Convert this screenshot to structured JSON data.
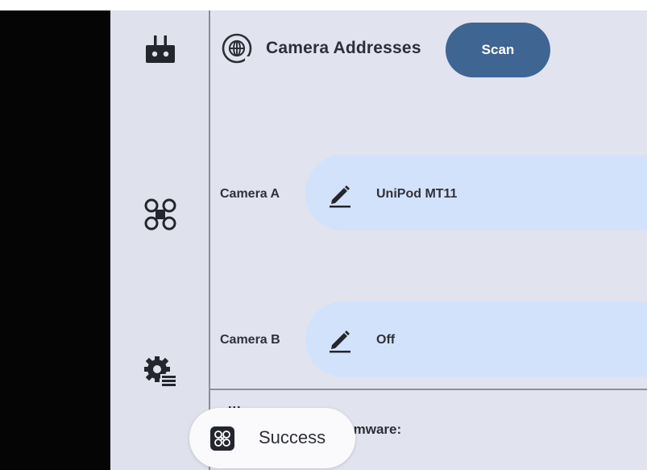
{
  "sidebar": {
    "items": [
      {
        "icon": "remote-controller-icon"
      },
      {
        "icon": "drone-icon"
      },
      {
        "icon": "settings-gear-list-icon"
      }
    ]
  },
  "header": {
    "icon": "network-globe-icon",
    "title": "Camera Addresses",
    "scan_label": "Scan"
  },
  "cameras": [
    {
      "label": "Camera A",
      "value": "UniPod MT11",
      "edit_icon": "pencil-edit-icon"
    },
    {
      "label": "Camera B",
      "value": "Off",
      "edit_icon": "pencil-edit-icon"
    }
  ],
  "firmware": {
    "label_visible": "rmware:"
  },
  "toast": {
    "icon": "drone-icon",
    "text": "Success"
  },
  "colors": {
    "accent": "#3f6593",
    "pill": "#d3e2fb",
    "sidebar": "#dfe1ec",
    "background": "#e1e3ee"
  }
}
